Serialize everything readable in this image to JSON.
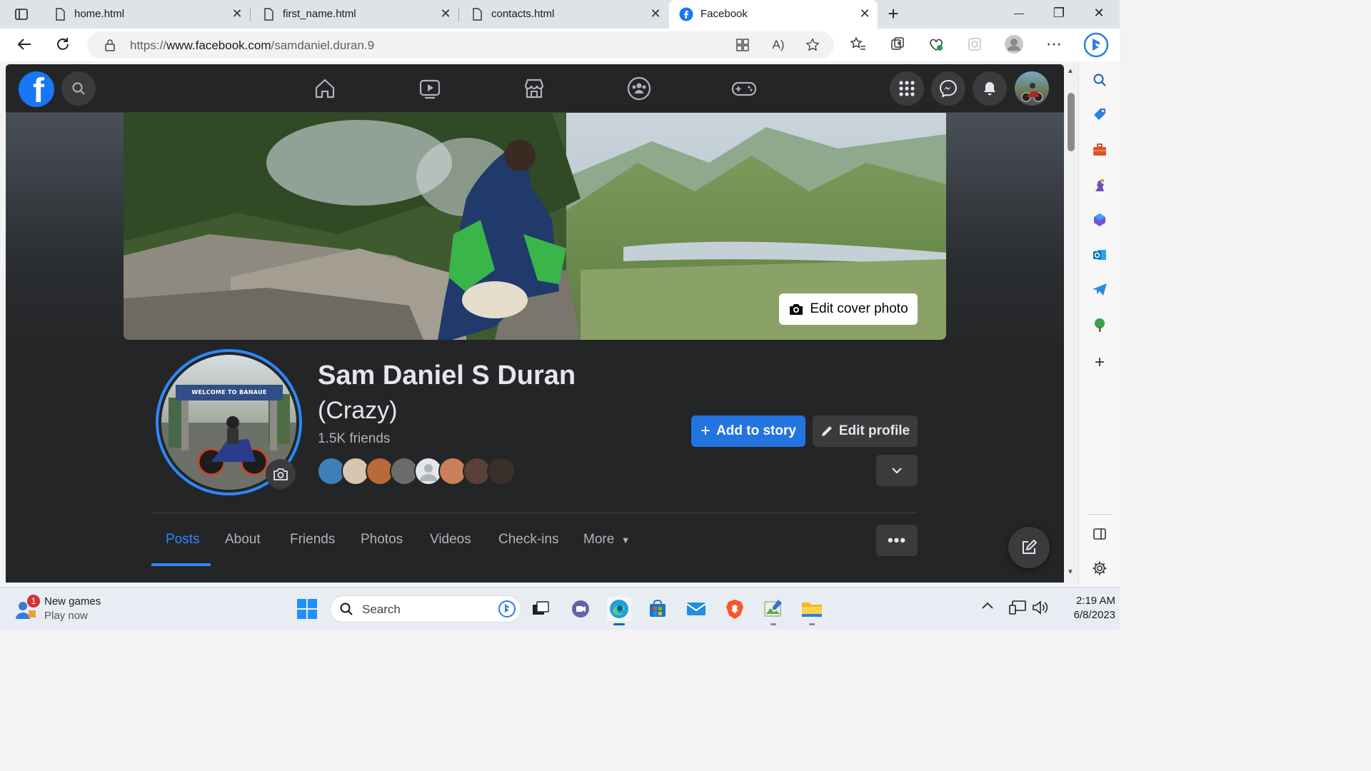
{
  "browser": {
    "tabs": [
      {
        "label": "home.html",
        "close": "✕"
      },
      {
        "label": "first_name.html",
        "close": "✕"
      },
      {
        "label": "contacts.html",
        "close": "✕"
      },
      {
        "label": "Facebook",
        "close": "✕"
      }
    ],
    "new_tab": "+",
    "window_controls": {
      "minimize": "—",
      "restore": "❐",
      "close": "✕"
    },
    "url_scheme": "https://",
    "url_host": "www.facebook.com",
    "url_path": "/samdaniel.duran.9"
  },
  "facebook": {
    "logo_letter": "f",
    "cover_button": "Edit cover photo",
    "profile_name": "Sam Daniel S Duran",
    "nickname": "(Crazy)",
    "friends_count": "1.5K friends",
    "avatar_sign": "WELCOME TO BANAUE",
    "add_story": "Add to story",
    "edit_profile": "Edit profile",
    "tabs": [
      "Posts",
      "About",
      "Friends",
      "Photos",
      "Videos",
      "Check-ins",
      "More"
    ],
    "active_tab": "Posts",
    "accent": "#2d88ff",
    "friend_avatar_colors": [
      "#3e7fb8",
      "#d9c4b0",
      "#b86a3a",
      "#6b6b6b",
      "#e4e6eb",
      "#c9805a",
      "#5a4036",
      "#3b2f2a"
    ]
  },
  "taskbar": {
    "notif_badge": "1",
    "widget_title": "New games",
    "widget_subtitle": "Play now",
    "search_placeholder": "Search",
    "time": "2:19 AM",
    "date": "6/8/2023"
  }
}
